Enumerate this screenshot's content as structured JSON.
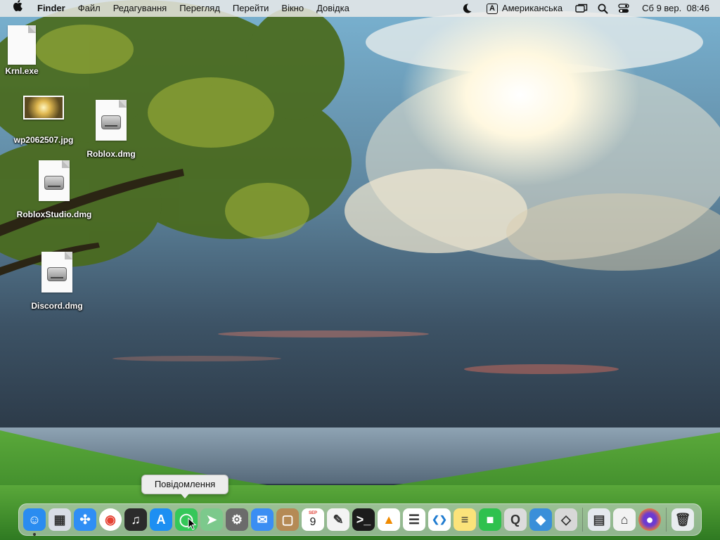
{
  "menubar": {
    "finder": "Finder",
    "items": [
      "Файл",
      "Редагування",
      "Перегляд",
      "Перейти",
      "Вікно",
      "Довідка"
    ],
    "input_badge": "A",
    "input_source": "Американська",
    "datetime": "Сб 9 вер.  08:46"
  },
  "desktop": {
    "icons": [
      {
        "label": "Krnl.exe",
        "type": "document"
      },
      {
        "label": "wp2062507.jpg",
        "type": "image"
      },
      {
        "label": "Roblox.dmg",
        "type": "disk-image"
      },
      {
        "label": "RobloxStudio.dmg",
        "type": "disk-image"
      },
      {
        "label": "Discord.dmg",
        "type": "disk-image"
      }
    ]
  },
  "tooltip": {
    "text": "Повідомлення"
  },
  "dock": {
    "apps": [
      {
        "name": "finder-icon",
        "color": "#2a8cf0",
        "glyph": "☺"
      },
      {
        "name": "launchpad-icon",
        "color": "#d9dde6",
        "glyph": "▦"
      },
      {
        "name": "safari-icon",
        "color": "#2f8ef5",
        "glyph": "✣"
      },
      {
        "name": "chrome-icon",
        "color": "#ffffff",
        "glyph": "◉"
      },
      {
        "name": "garageband-icon",
        "color": "#2b2b2b",
        "glyph": "♫"
      },
      {
        "name": "app-store-icon",
        "color": "#1d8ff2",
        "glyph": "A"
      },
      {
        "name": "messages-icon",
        "color": "#35c759",
        "glyph": "◯"
      },
      {
        "name": "maps-icon",
        "color": "#7cc98c",
        "glyph": "➤"
      },
      {
        "name": "system-preferences-icon",
        "color": "#6b6b6b",
        "glyph": "⚙"
      },
      {
        "name": "mail-icon",
        "color": "#3b8ef3",
        "glyph": "✉"
      },
      {
        "name": "notes-brown-icon",
        "color": "#b58a55",
        "glyph": "▢"
      },
      {
        "name": "calendar-icon",
        "color": "#ffffff",
        "glyph": "9",
        "month": "SEP"
      },
      {
        "name": "textedit-icon",
        "color": "#f3f3f3",
        "glyph": "✎"
      },
      {
        "name": "terminal-icon",
        "color": "#1c1c1c",
        "glyph": ">_"
      },
      {
        "name": "vlc-icon",
        "color": "#ffffff",
        "glyph": "▲"
      },
      {
        "name": "reminders-icon",
        "color": "#ffffff",
        "glyph": "☰"
      },
      {
        "name": "vscode-icon",
        "color": "#ffffff",
        "glyph": "❮❯"
      },
      {
        "name": "notes-icon",
        "color": "#fbe37a",
        "glyph": "≡"
      },
      {
        "name": "facetime-icon",
        "color": "#2fc14e",
        "glyph": "■"
      },
      {
        "name": "quicktime-icon",
        "color": "#dcdcdc",
        "glyph": "Q"
      },
      {
        "name": "roblox-studio-icon",
        "color": "#3a8fd9",
        "glyph": "◆"
      },
      {
        "name": "roblox-icon",
        "color": "#d8d8d8",
        "glyph": "◇"
      }
    ],
    "right_apps": [
      {
        "name": "preview-icon",
        "color": "#e5e9ee",
        "glyph": "▤"
      },
      {
        "name": "automator-icon",
        "color": "#f2f2f2",
        "glyph": "⌂"
      },
      {
        "name": "firefox-icon",
        "color": "#6c3bd1",
        "glyph": "●"
      }
    ],
    "trash": {
      "name": "trash-icon",
      "color": "#e8ecef",
      "glyph": "🗑"
    }
  }
}
